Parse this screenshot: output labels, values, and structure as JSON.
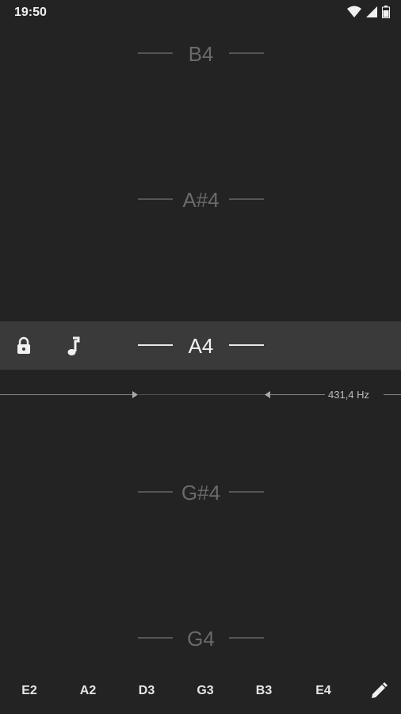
{
  "status_bar": {
    "time": "19:50",
    "icons": [
      "wifi-icon",
      "signal-icon",
      "battery-icon"
    ]
  },
  "notes_above": [
    {
      "label": "B4"
    },
    {
      "label": "A#4"
    }
  ],
  "current_note": {
    "label": "A4",
    "lock_icon": "lock-icon",
    "note_icon": "music-note-icon"
  },
  "frequency": {
    "readout": "431,4 Hz"
  },
  "notes_below": [
    {
      "label": "G#4"
    },
    {
      "label": "G4"
    }
  ],
  "strings": {
    "items": [
      "E2",
      "A2",
      "D3",
      "G3",
      "B3",
      "E4"
    ],
    "edit_icon": "pencil-icon"
  },
  "colors": {
    "background": "#232323",
    "band": "#3a3a3a",
    "dim_note": "#6a6a6a",
    "active_note": "#f2f2f2"
  }
}
